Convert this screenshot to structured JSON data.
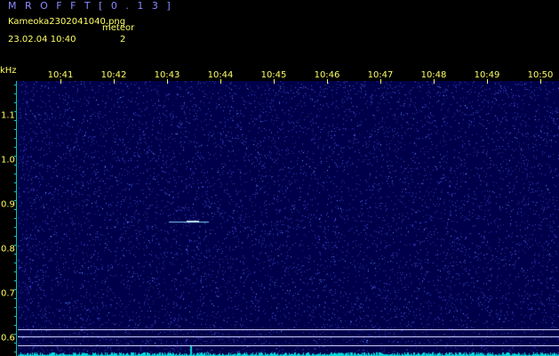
{
  "header": {
    "app_title": "M R O F F T  [ 0 . 1 3 ]",
    "filename": "Kameoka2302041040.png",
    "meteor_label": "meteor",
    "datetime": "23.02.04  10:40",
    "meteor_count": "2"
  },
  "axis": {
    "unit": "kHz",
    "time_ticks": [
      "10:41",
      "10:42",
      "10:43",
      "10:44",
      "10:45",
      "10:46",
      "10:47",
      "10:48",
      "10:49",
      "10:50"
    ],
    "freq_ticks": [
      "1.1",
      "1.0",
      "0.9",
      "0.8",
      "0.7",
      "0.6"
    ]
  },
  "colors": {
    "background": "#000000",
    "spectrogram_bg": "#00004a",
    "label_yellow": "#ffff66",
    "title_blue": "#8a8aff",
    "axis_cyan": "#00c8c8"
  }
}
